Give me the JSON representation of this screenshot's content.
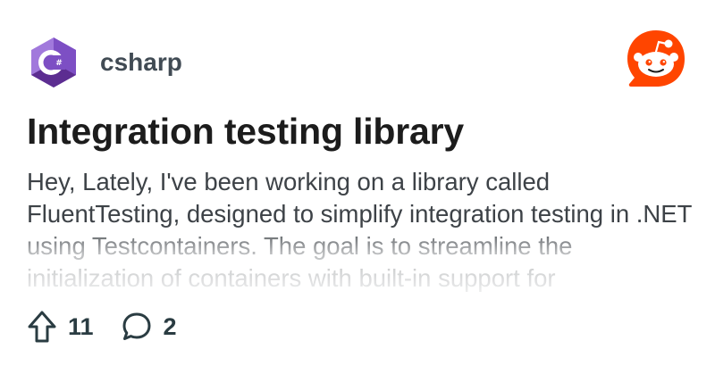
{
  "subreddit": {
    "name": "csharp",
    "icon": "csharp-hexagon-icon",
    "icon_text": "C#",
    "icon_color": "#68217a"
  },
  "brand": {
    "icon": "reddit-snoo-icon",
    "color": "#ff4500"
  },
  "post": {
    "title": "Integration testing library",
    "body": "Hey, Lately, I've been working on a library called FluentTesting, designed to simplify integration testing in .NET using Testcontainers. The goal is to streamline the initialization of containers with built-in support for"
  },
  "stats": {
    "upvotes": "11",
    "upvote_icon": "upvote-arrow-icon",
    "comments": "2",
    "comment_icon": "comment-bubble-icon"
  }
}
